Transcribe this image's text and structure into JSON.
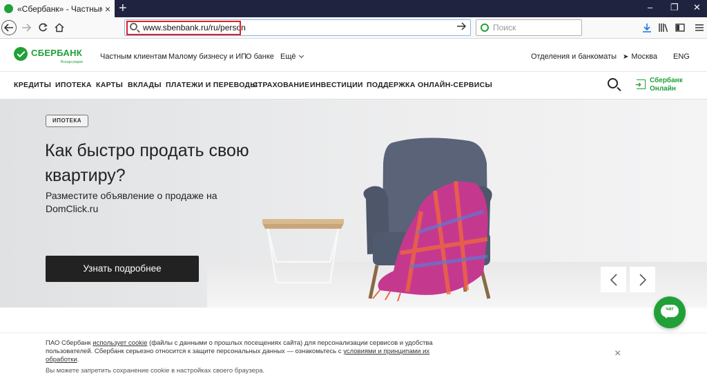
{
  "browser": {
    "tab_title": "«Сбербанк» - Частным клиен",
    "tab_close": "×",
    "new_tab": "+",
    "url": "www.sbenbank.ru/ru/person",
    "search_placeholder": "Поиск",
    "win_min": "–",
    "win_max": "❐",
    "win_close": "✕"
  },
  "header": {
    "logo_word": "СБЕРБАНК",
    "logo_tagline": "Всегда рядом",
    "nav": [
      "Частным клиентам",
      "Малому бизнесу и ИП",
      "О банке",
      "Ещё"
    ],
    "offices": "Отделения и банкоматы",
    "city": "Москва",
    "lang": "ENG"
  },
  "mainnav": {
    "items": [
      "КРЕДИТЫ",
      "ИПОТЕКА",
      "КАРТЫ",
      "ВКЛАДЫ",
      "ПЛАТЕЖИ И ПЕРЕВОДЫ",
      "СТРАХОВАНИЕ",
      "ИНВЕСТИЦИИ",
      "ПОДДЕРЖКА",
      "ОНЛАЙН-СЕРВИСЫ"
    ],
    "login_line1": "Сбербанк",
    "login_line2": "Онлайн"
  },
  "hero": {
    "badge": "ИПОТЕКА",
    "title": "Как быстро продать свою квартиру?",
    "subtitle": "Разместите объявление о продаже на DomClick.ru",
    "cta": "Узнать подробнее",
    "prev": "‹",
    "next": "›"
  },
  "chat": {
    "label": "чат"
  },
  "cookie": {
    "t1": "ПАО Сбербанк ",
    "link1": "использует cookie",
    "t2": " (файлы с данными о прошлых посещениях сайта) для персонализации сервисов и удобства пользователей. Сбербанк серьезно относится к защите персональных данных — ознакомьтесь с ",
    "link2": "условиями и принципами их обработки",
    "t3": ".",
    "note": "Вы можете запретить сохранение cookie в настройках своего браузера.",
    "close": "×"
  },
  "colors": {
    "brand": "#21a038",
    "dark": "#222222",
    "tabstrip": "#202340"
  }
}
